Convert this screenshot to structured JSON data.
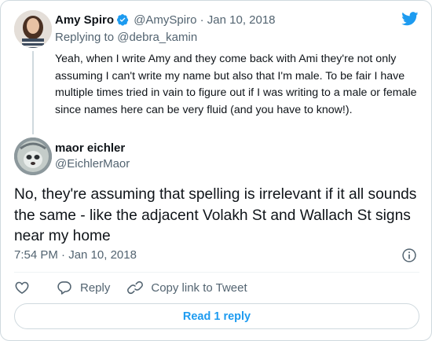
{
  "parent_tweet": {
    "display_name": "Amy Spiro",
    "handle": "@AmySpiro",
    "separator": "·",
    "date": "Jan 10, 2018",
    "replying_prefix": "Replying to",
    "replying_to": "@debra_kamin",
    "text": "Yeah, when I write Amy and they come back with Ami they're not only assuming I can't write my name but also that I'm male. To be fair I have multiple times tried in vain to figure out if I was writing to a male or female since names here can be very fluid (and you have to know!)."
  },
  "main_tweet": {
    "display_name": "maor eichler",
    "handle": "@EichlerMaor",
    "text": "No, they're assuming that spelling is irrelevant if it all sounds the same - like the adjacent Volakh St and Wallach St signs near my home",
    "timestamp": "7:54 PM · Jan 10, 2018"
  },
  "actions": {
    "like_icon": "heart-icon",
    "reply_label": "Reply",
    "copy_link_label": "Copy link to Tweet"
  },
  "read_replies_label": "Read 1 reply",
  "colors": {
    "accent": "#1d9bf0",
    "text": "#0f1419",
    "muted": "#536471",
    "border": "#cfd9de"
  }
}
